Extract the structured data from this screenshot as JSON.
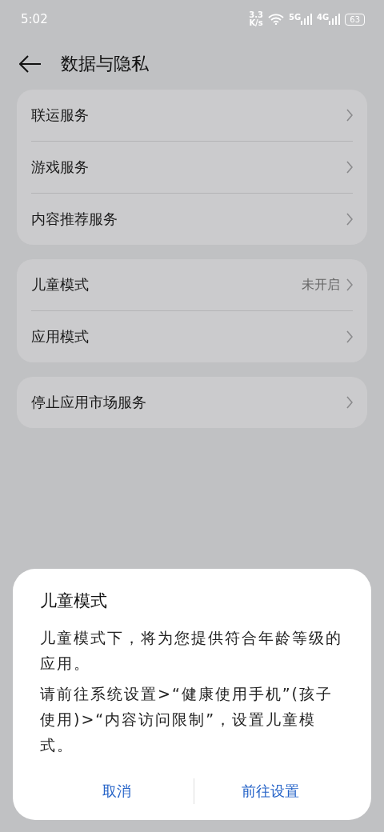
{
  "status_bar": {
    "time": "5:02",
    "speed_value": "3.3",
    "speed_unit": "K/s",
    "networks": [
      "5G",
      "4G"
    ],
    "battery": "63"
  },
  "header": {
    "title": "数据与隐私"
  },
  "groups": [
    [
      {
        "label": "联运服务"
      },
      {
        "label": "游戏服务"
      },
      {
        "label": "内容推荐服务"
      }
    ],
    [
      {
        "label": "儿童模式",
        "value": "未开启"
      },
      {
        "label": "应用模式"
      }
    ],
    [
      {
        "label": "停止应用市场服务"
      }
    ]
  ],
  "dialog": {
    "title": "儿童模式",
    "paragraphs": [
      "儿童模式下，将为您提供符合年龄等级的应用。",
      "请前往系统设置>“健康使用手机”(孩子使用)>“内容访问限制”，设置儿童模式。"
    ],
    "buttons": [
      "取消",
      "前往设置"
    ]
  }
}
